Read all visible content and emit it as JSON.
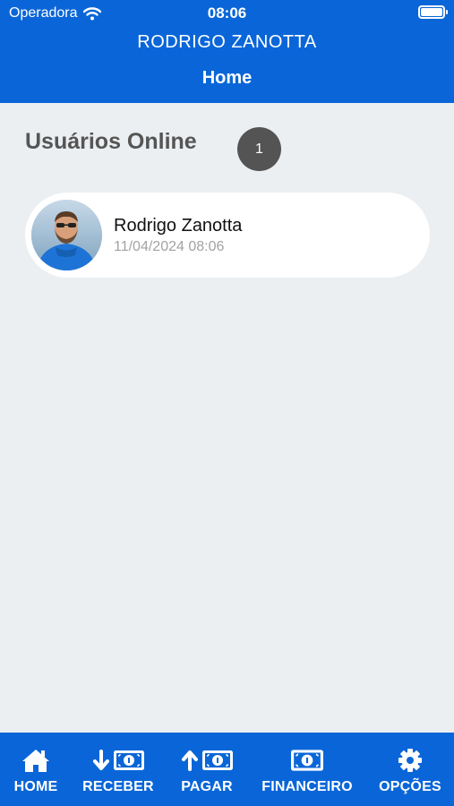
{
  "status_bar": {
    "carrier": "Operadora",
    "time": "08:06"
  },
  "header": {
    "user_name": "RODRIGO ZANOTTA",
    "title": "Home"
  },
  "online": {
    "section_title": "Usuários Online",
    "count": "1",
    "users": [
      {
        "name": "Rodrigo Zanotta",
        "last_seen": "11/04/2024 08:06"
      }
    ]
  },
  "tabbar": {
    "items": [
      {
        "label": "HOME",
        "icon": "home-icon"
      },
      {
        "label": "RECEBER",
        "icon": "arrow-down-money-icon"
      },
      {
        "label": "PAGAR",
        "icon": "arrow-up-money-icon"
      },
      {
        "label": "FINANCEIRO",
        "icon": "money-icon"
      },
      {
        "label": "OPÇÕES",
        "icon": "gear-icon"
      }
    ]
  },
  "colors": {
    "primary": "#0a66d8",
    "background": "#ebeff1",
    "badge": "#545454"
  }
}
